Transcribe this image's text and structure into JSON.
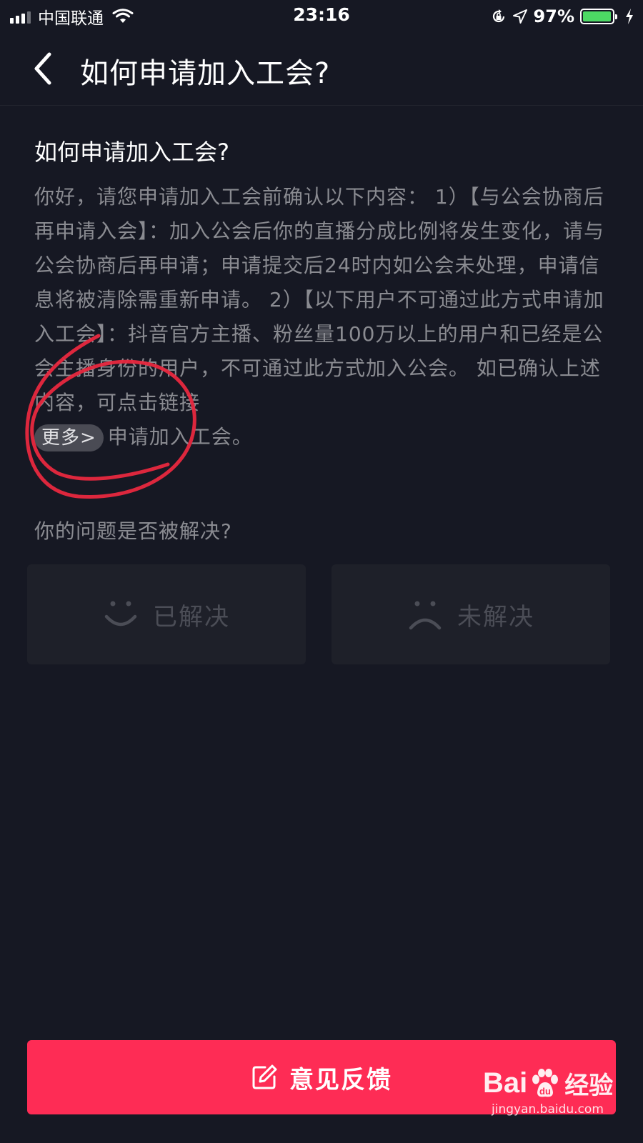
{
  "status_bar": {
    "carrier": "中国联通",
    "time": "23:16",
    "battery_percent": "97%",
    "battery_level": 0.97,
    "icons": [
      "signal-icon",
      "wifi-icon",
      "rotation-lock-icon",
      "location-icon",
      "battery-icon",
      "charging-icon"
    ]
  },
  "nav": {
    "title": "如何申请加入工会?",
    "back_icon": "chevron-left-icon"
  },
  "article": {
    "title": "如何申请加入工会?",
    "body": "你好，请您申请加入工会前确认以下内容： 1）【与公会协商后再申请入会】：加入公会后你的直播分成比例将发生变化，请与公会协商后再申请；申请提交后24时内如公会未处理，申请信息将被清除需重新申请。 2）【以下用户不可通过此方式申请加入工会】：抖音官方主播、粉丝量100万以上的用户和已经是公会主播身份的用户，不可通过此方式加入公会。 如已确认上述内容，可点击链接",
    "more_link": "更多>",
    "tail": "申请加入工会。"
  },
  "feedback_question": {
    "question": "你的问题是否被解决?",
    "resolved_label": "已解决",
    "unresolved_label": "未解决"
  },
  "footer": {
    "feedback_label": "意见反馈"
  },
  "watermark": {
    "brand": "Baidu经验",
    "url": "jingyan.baidu.com"
  },
  "colors": {
    "background": "#161823",
    "accent": "#fe2c55",
    "annotation": "#e8283f"
  }
}
